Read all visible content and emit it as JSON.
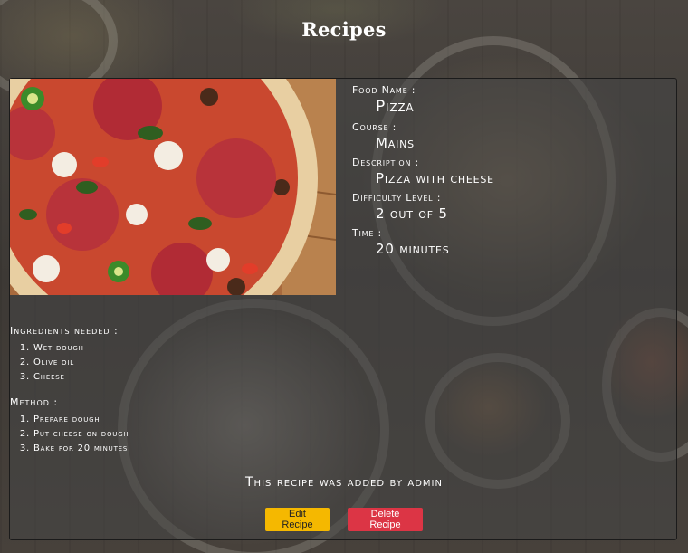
{
  "page": {
    "title": "Recipes"
  },
  "recipe": {
    "image_alt": "Pizza",
    "fields": [
      {
        "label": "Food Name :",
        "value": "Pizza"
      },
      {
        "label": "Course :",
        "value": "Mains"
      },
      {
        "label": "Description :",
        "value": "Pizza with cheese"
      },
      {
        "label": "Difficulty Level :",
        "value": "2 out of 5"
      },
      {
        "label": "Time :",
        "value": "20 minutes"
      }
    ],
    "ingredients_title": "Ingredients needed :",
    "ingredients": [
      "Wet dough",
      "Olive oil",
      "Cheese"
    ],
    "method_title": "Method :",
    "method": [
      "Prepare dough",
      "Put cheese on dough",
      "Bake for 20 minutes"
    ],
    "added_by_text": "This recipe was added by admin"
  },
  "actions": {
    "edit_label": "Edit Recipe",
    "delete_label": "Delete Recipe"
  },
  "colors": {
    "edit_button": "#f5b800",
    "delete_button": "#dc3545",
    "card_border": "#1b1b1b"
  }
}
